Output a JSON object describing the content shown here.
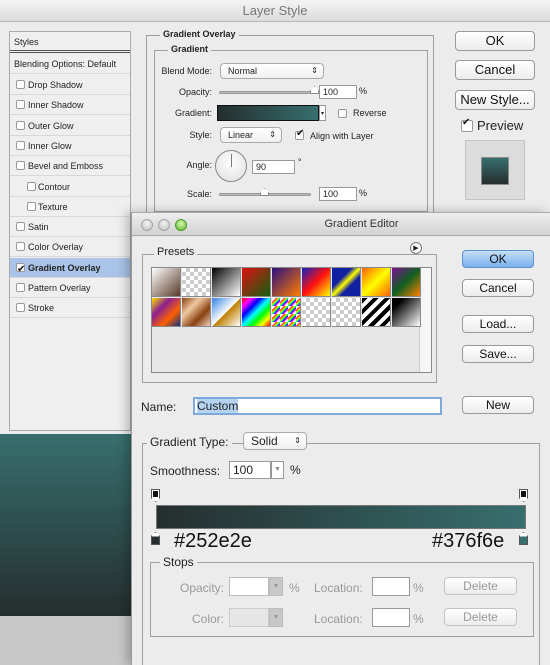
{
  "layer_style": {
    "title": "Layer Style",
    "styles_list": {
      "header": "Styles",
      "blending": "Blending Options: Default",
      "items": [
        {
          "label": "Drop Shadow",
          "checked": false,
          "sub": false
        },
        {
          "label": "Inner Shadow",
          "checked": false,
          "sub": false
        },
        {
          "label": "Outer Glow",
          "checked": false,
          "sub": false
        },
        {
          "label": "Inner Glow",
          "checked": false,
          "sub": false
        },
        {
          "label": "Bevel and Emboss",
          "checked": false,
          "sub": false
        },
        {
          "label": "Contour",
          "checked": false,
          "sub": true
        },
        {
          "label": "Texture",
          "checked": false,
          "sub": true
        },
        {
          "label": "Satin",
          "checked": false,
          "sub": false
        },
        {
          "label": "Color Overlay",
          "checked": false,
          "sub": false
        },
        {
          "label": "Gradient Overlay",
          "checked": true,
          "sub": false,
          "selected": true
        },
        {
          "label": "Pattern Overlay",
          "checked": false,
          "sub": false
        },
        {
          "label": "Stroke",
          "checked": false,
          "sub": false
        }
      ]
    },
    "panel": {
      "group_title": "Gradient Overlay",
      "sub_title": "Gradient",
      "blend_mode_label": "Blend Mode:",
      "blend_mode_value": "Normal",
      "opacity_label": "Opacity:",
      "opacity_value": "100",
      "opacity_fraction": 1.0,
      "percent": "%",
      "gradient_label": "Gradient:",
      "reverse_label": "Reverse",
      "reverse_checked": false,
      "style_label": "Style:",
      "style_value": "Linear",
      "align_label": "Align with Layer",
      "align_checked": true,
      "angle_label": "Angle:",
      "angle_value": "90",
      "degree": "°",
      "scale_label": "Scale:",
      "scale_value": "100",
      "scale_fraction": 0.5
    },
    "buttons": {
      "ok": "OK",
      "cancel": "Cancel",
      "new_style": "New Style...",
      "preview_label": "Preview",
      "preview_checked": true
    }
  },
  "gradient_editor": {
    "title": "Gradient Editor",
    "presets_label": "Presets",
    "buttons": {
      "ok": "OK",
      "cancel": "Cancel",
      "load": "Load...",
      "save": "Save...",
      "new": "New"
    },
    "name_label": "Name:",
    "name_value": "Custom",
    "gradient_type_label": "Gradient Type:",
    "gradient_type_value": "Solid",
    "smoothness_label": "Smoothness:",
    "smoothness_value": "100",
    "percent": "%",
    "color_start": "#252e2e",
    "color_end": "#376f6e",
    "stops": {
      "title": "Stops",
      "opacity_label": "Opacity:",
      "color_label": "Color:",
      "location_label": "Location:",
      "delete_label": "Delete"
    }
  },
  "colors": {
    "gradient_start": "#252e2e",
    "gradient_end": "#376f6e",
    "selection": "#a9c4e8",
    "default_button": "#78b0eb"
  }
}
